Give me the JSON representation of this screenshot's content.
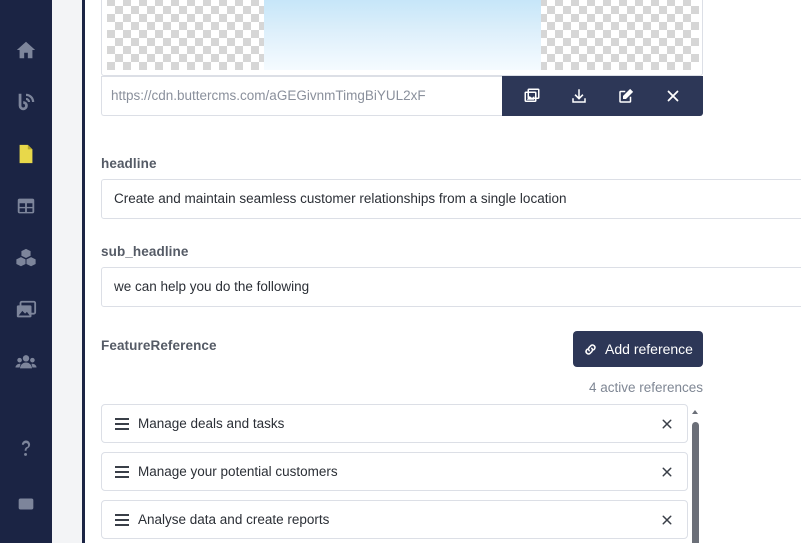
{
  "sidebar": {
    "items": [
      {
        "icon": "home-icon"
      },
      {
        "icon": "blog-icon"
      },
      {
        "icon": "pages-icon",
        "active": true
      },
      {
        "icon": "collections-icon"
      },
      {
        "icon": "components-icon"
      },
      {
        "icon": "media-icon"
      },
      {
        "icon": "users-icon"
      },
      {
        "icon": "help-icon"
      },
      {
        "icon": "chat-icon"
      }
    ],
    "active_color": "#e8d84a"
  },
  "image_field": {
    "url": "https://cdn.buttercms.com/aGEGivnmTimgBiYUL2xF",
    "actions": [
      "replace-image-icon",
      "download-icon",
      "edit-icon",
      "close-icon"
    ]
  },
  "headline": {
    "label": "headline",
    "value": "Create and maintain seamless customer relationships from a single location"
  },
  "sub_headline": {
    "label": "sub_headline",
    "value": "we can help you do the following"
  },
  "feature_reference": {
    "label": "FeatureReference",
    "add_button": "Add reference",
    "count_text": "4 active references",
    "items": [
      {
        "label": "Manage deals and tasks"
      },
      {
        "label": "Manage your potential customers"
      },
      {
        "label": "Analyse data and create reports"
      }
    ]
  },
  "colors": {
    "sidebar_bg": "#1b2444",
    "button_bg": "#2d3757",
    "icon_color": "#7d859b"
  }
}
